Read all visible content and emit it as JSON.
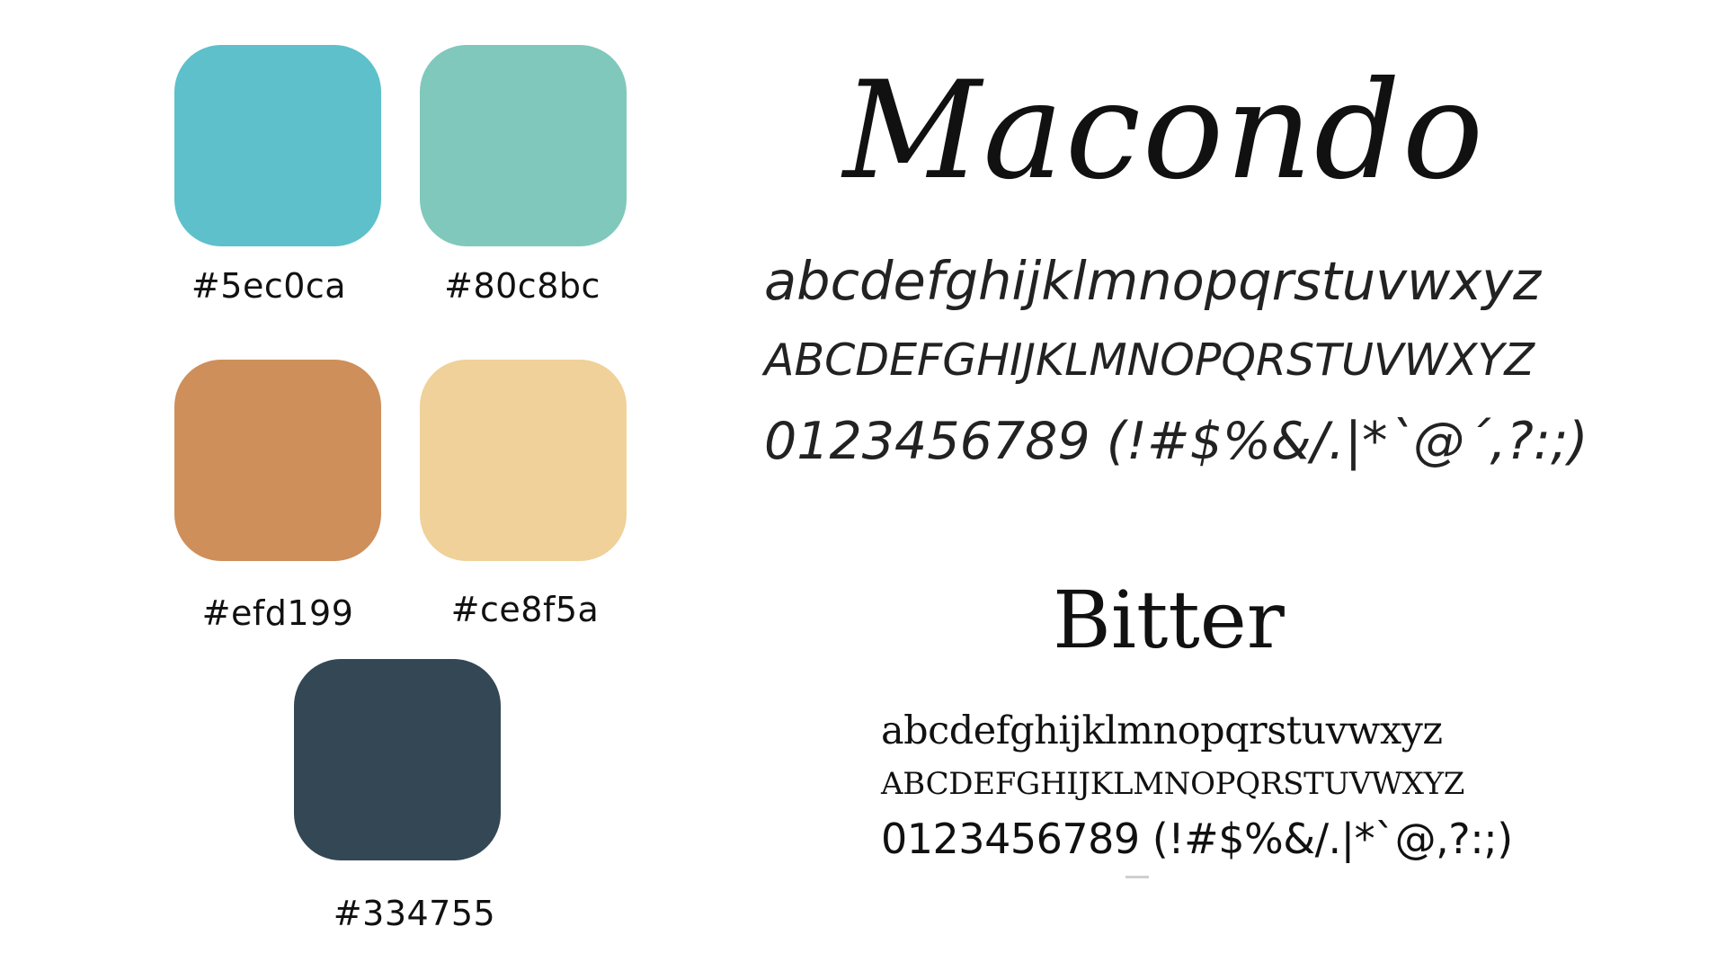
{
  "palette": [
    {
      "label": "#5ec0ca",
      "color": "#5ec0ca"
    },
    {
      "label": "#80c8bc",
      "color": "#80c8bc"
    },
    {
      "label": "#efd199",
      "color": "#ce8f5a"
    },
    {
      "label": "#ce8f5a",
      "color": "#efd199"
    },
    {
      "label": "#334755",
      "color": "#334755"
    }
  ],
  "fonts": {
    "macondo": {
      "name": "Macondo",
      "lowercase": "abcdefghijklmnopqrstuvwxyz",
      "uppercase": "ABCDEFGHIJKLMNOPQRSTUVWXYZ",
      "digits_symbols": "0123456789 (!#$%&/.|*`@´,?:;)"
    },
    "bitter": {
      "name": "Bitter",
      "lowercase": "abcdefghijklmnopqrstuvwxyz",
      "uppercase": "ABCDEFGHIJKLMNOPQRSTUVWXYZ",
      "digits_symbols": "0123456789 (!#$%&/.|*`@,?:;)"
    }
  }
}
